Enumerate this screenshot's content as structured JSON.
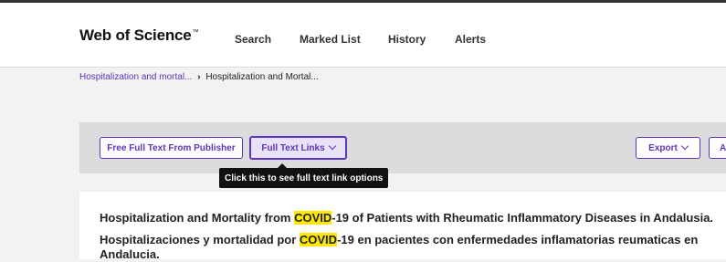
{
  "header": {
    "logo_text": "Web of Science",
    "logo_tm": "™",
    "nav": [
      "Search",
      "Marked List",
      "History",
      "Alerts"
    ]
  },
  "breadcrumb": {
    "link": "Hospitalization and mortal...",
    "separator": "›",
    "current": "Hospitalization and Mortal..."
  },
  "toolbar": {
    "free_full_text_label": "Free Full Text From Publisher",
    "full_text_links_label": "Full Text Links",
    "export_label": "Export",
    "cut_button_label": "A",
    "tooltip": "Click this to see full text link options"
  },
  "record": {
    "title_en_pre": "Hospitalization and Mortality from ",
    "title_en_hl": "COVID",
    "title_en_post": "-19 of Patients with Rheumatic Inflammatory Diseases in Andalusia.",
    "title_es_pre": "Hospitalizaciones y mortalidad por ",
    "title_es_hl": "COVID",
    "title_es_post": "-19 en pacientes con enfermedades inflamatorias reumaticas en",
    "title_es_line2": "Andalucia."
  },
  "colors": {
    "accent": "#5e33bf",
    "highlight": "#ffe800",
    "tooltip_bg": "#111111"
  }
}
